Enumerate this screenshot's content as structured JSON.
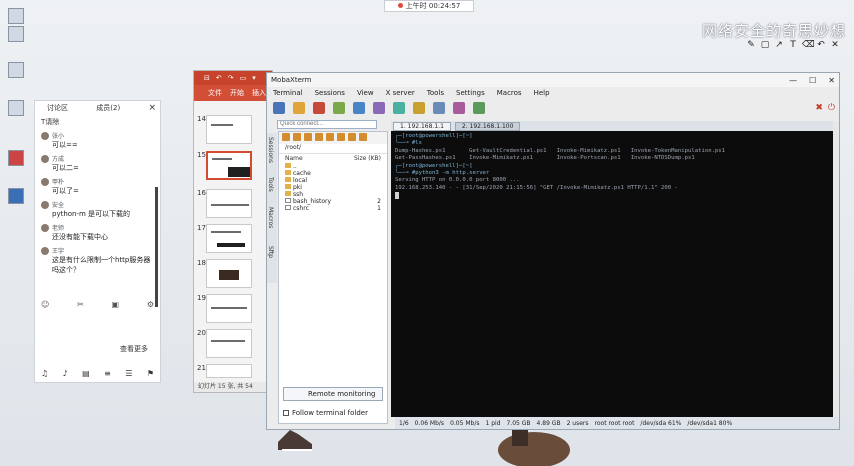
{
  "top_clock": "上午时 00:24:57",
  "watermark": "网络安全的奇思妙想",
  "desktop_icons": [
    "",
    "",
    "",
    "",
    ""
  ],
  "chat": {
    "tab_title": "讨论区",
    "tab_count": "成员(2)",
    "close": "×",
    "subtitle": "T请除",
    "messages": [
      {
        "name": "张小",
        "text": "可以=="
      },
      {
        "name": "方成",
        "text": "可以二="
      },
      {
        "name": "甲朴",
        "text": "可以了="
      },
      {
        "name": "安全",
        "text": "python-m 是可以下载的"
      },
      {
        "name": "老师",
        "text": "还没有能下载中心"
      },
      {
        "name": "王宇",
        "text": "这是有什么限制一个http服务器吗这个？"
      }
    ],
    "more_label": "查看更多",
    "mid_tools": [
      "☺",
      "✂",
      "▣",
      "⚙"
    ],
    "bottom_tools": [
      "♫",
      "♪",
      "▤",
      "≡",
      "☰",
      "⚑"
    ]
  },
  "ppt": {
    "title_glyphs": [
      "⊟",
      "↶",
      "↷",
      "▭",
      "▾"
    ],
    "ribbon": [
      "文件",
      "开始",
      "插入"
    ],
    "slide_numbers": [
      "14",
      "15",
      "16",
      "17",
      "18",
      "19",
      "20",
      "21"
    ],
    "status": "幻灯片 15 张, 共 54"
  },
  "moba": {
    "title": "MobaXterm",
    "window_buttons": [
      "—",
      "☐",
      "✕"
    ],
    "menu": [
      "Terminal",
      "Sessions",
      "View",
      "X server",
      "Tools",
      "Settings",
      "Macros",
      "Help"
    ],
    "quick_connect_placeholder": "Quick connect...",
    "side_tabs": [
      "Sessions",
      "Tools",
      "Macros",
      "Sftp"
    ],
    "sftp": {
      "path": "/root/",
      "col_name": "Name",
      "col_size": "Size (KB)",
      "files": [
        {
          "name": "..",
          "size": ""
        },
        {
          "name": "cache",
          "size": ""
        },
        {
          "name": "local",
          "size": ""
        },
        {
          "name": "pki",
          "size": ""
        },
        {
          "name": "ssh",
          "size": ""
        },
        {
          "name": "bash_history",
          "size": "2"
        },
        {
          "name": "cshrc",
          "size": "1"
        }
      ],
      "remote_monitoring": "Remote monitoring",
      "follow_terminal": "Follow terminal folder"
    },
    "terminal": {
      "tabs": [
        "1. 192.168.1.1",
        "2. 192.168.1.100"
      ],
      "lines": [
        {
          "kind": "prompt",
          "text": "┌─[root@powershell]─[~]"
        },
        {
          "kind": "prompt",
          "text": "└──╼ #ls"
        },
        {
          "kind": "out",
          "text": "Dump-Hashes.ps1       Get-VaultCredential.ps1   Invoke-Mimikatz.ps1   Invoke-TokenManipulation.ps1"
        },
        {
          "kind": "out",
          "text": "Get-PassHashes.ps1    Invoke-Mimikatz.ps1       Invoke-Portscan.ps1   Invoke-NTDSDump.ps1"
        },
        {
          "kind": "prompt",
          "text": "┌─[root@powershell]─[~]"
        },
        {
          "kind": "prompt",
          "text": "└──╼ #python3 -m http.server"
        },
        {
          "kind": "out",
          "text": "Serving HTTP on 0.0.0.0 port 8000 ..."
        },
        {
          "kind": "out",
          "text": "192.168.253.140 - - [31/Sep/2020 21:15:56] \"GET /Invoke-Mimikatz.ps1 HTTP/1.1\" 200 -"
        }
      ]
    },
    "status": [
      "1/6",
      "0.06 Mb/s",
      "0.05 Mb/s",
      "1 pid",
      "7.05 GB",
      "4.89 GB",
      "2 users",
      "root root root",
      "/dev/sda 61%",
      "/dev/sda1 80%"
    ]
  }
}
